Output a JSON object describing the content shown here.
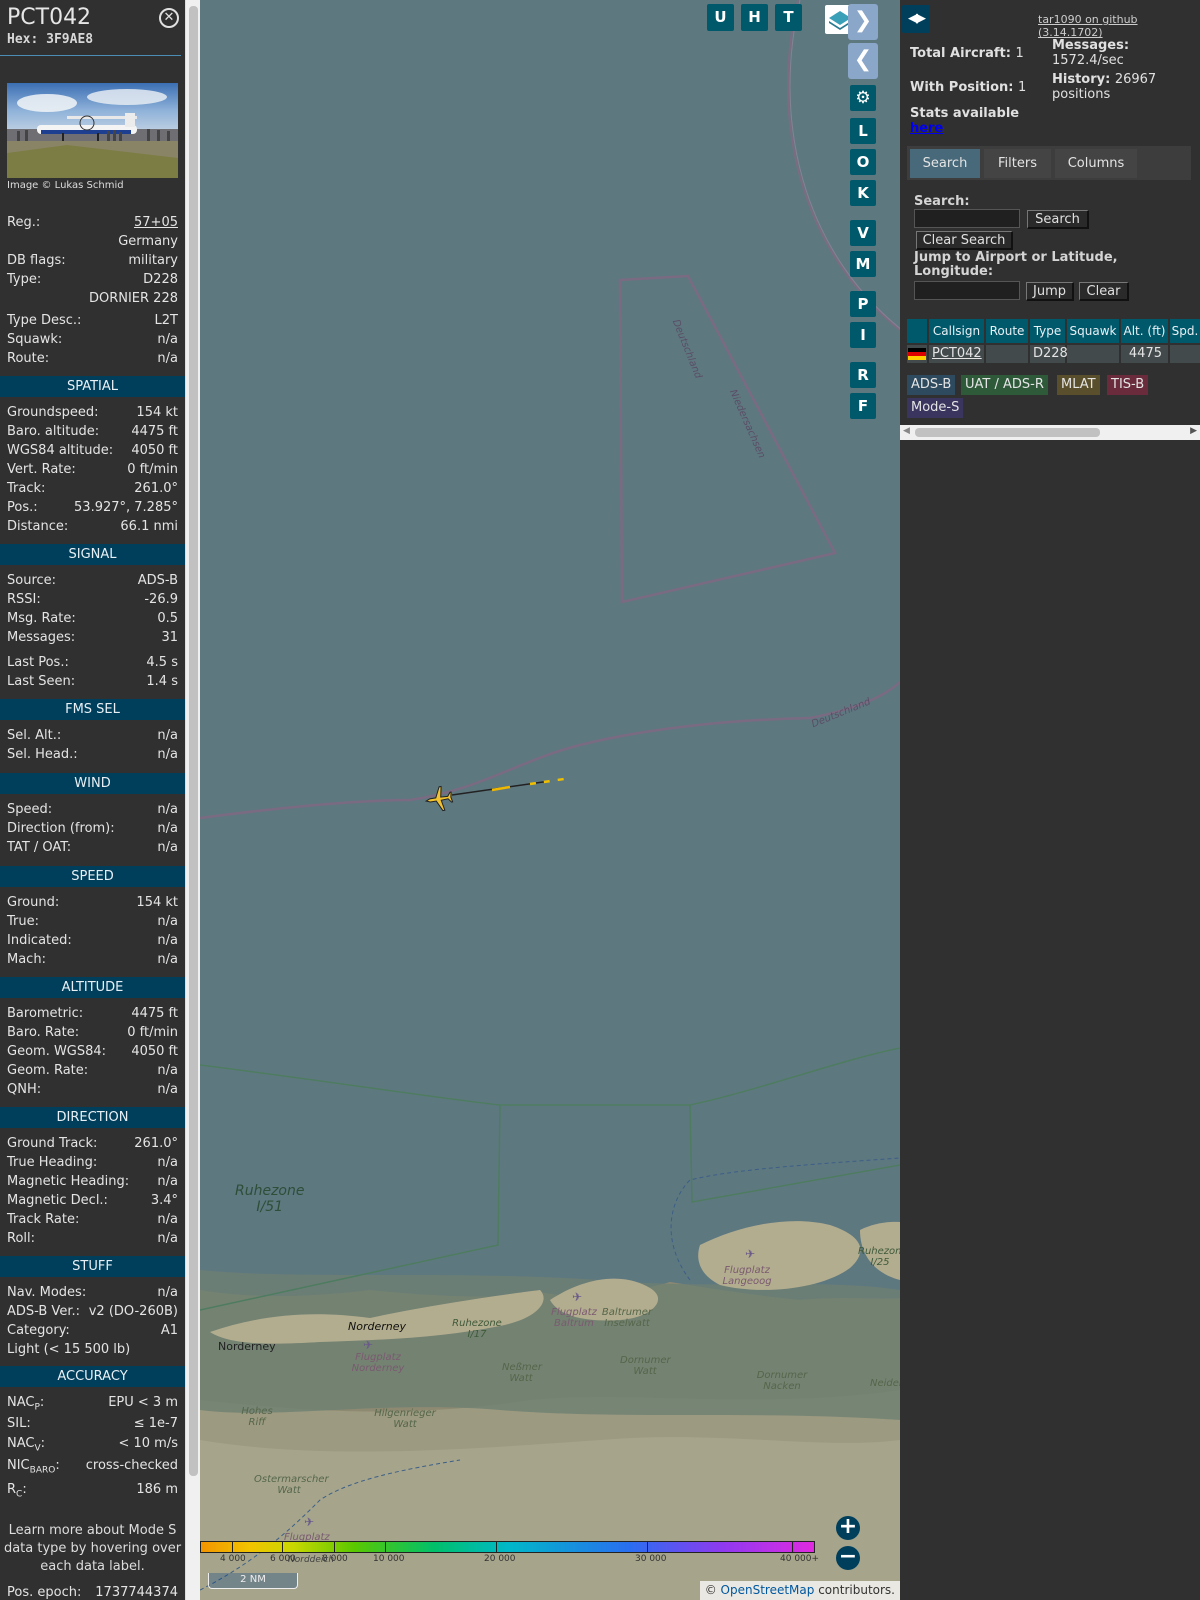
{
  "aircraft": {
    "callsign": "PCT042",
    "hex": "Hex: 3F9AE8",
    "photo_credit": "Image © Lukas Schmid",
    "reg_label": "Reg.:",
    "reg_value": "57+05",
    "country": "Germany",
    "dbflags_label": "DB flags:",
    "dbflags_value": "military",
    "type_label": "Type:",
    "type_value": "D228",
    "type_name": "DORNIER 228",
    "typedesc_label": "Type Desc.:",
    "typedesc_value": "L2T",
    "squawk_label": "Squawk:",
    "squawk_value": "n/a",
    "route_label": "Route:",
    "route_value": "n/a"
  },
  "sections": {
    "spatial": "SPATIAL",
    "signal": "SIGNAL",
    "fms": "FMS SEL",
    "wind": "WIND",
    "speed": "SPEED",
    "altitude": "ALTITUDE",
    "direction": "DIRECTION",
    "stuff": "STUFF",
    "accuracy": "ACCURACY"
  },
  "spatial": [
    [
      "Groundspeed:",
      "154 kt"
    ],
    [
      "Baro. altitude:",
      "4475 ft"
    ],
    [
      "WGS84 altitude:",
      "4050 ft"
    ],
    [
      "Vert. Rate:",
      "0 ft/min"
    ],
    [
      "Track:",
      "261.0°"
    ],
    [
      "Pos.:",
      "53.927°, 7.285°"
    ],
    [
      "Distance:",
      "66.1 nmi"
    ]
  ],
  "signal": [
    [
      "Source:",
      "ADS-B"
    ],
    [
      "RSSI:",
      "-26.9"
    ],
    [
      "Msg. Rate:",
      "0.5"
    ],
    [
      "Messages:",
      "31"
    ],
    [
      "Last Pos.:",
      "4.5 s"
    ],
    [
      "Last Seen:",
      "1.4 s"
    ]
  ],
  "fms": [
    [
      "Sel. Alt.:",
      "n/a"
    ],
    [
      "Sel. Head.:",
      "n/a"
    ]
  ],
  "wind": [
    [
      "Speed:",
      "n/a"
    ],
    [
      "Direction (from):",
      "n/a"
    ],
    [
      "TAT / OAT:",
      "n/a"
    ]
  ],
  "speed": [
    [
      "Ground:",
      "154 kt"
    ],
    [
      "True:",
      "n/a"
    ],
    [
      "Indicated:",
      "n/a"
    ],
    [
      "Mach:",
      "n/a"
    ]
  ],
  "altitude": [
    [
      "Barometric:",
      "4475 ft"
    ],
    [
      "Baro. Rate:",
      "0 ft/min"
    ],
    [
      "Geom. WGS84:",
      "4050 ft"
    ],
    [
      "Geom. Rate:",
      "n/a"
    ],
    [
      "QNH:",
      "n/a"
    ]
  ],
  "direction": [
    [
      "Ground Track:",
      "261.0°"
    ],
    [
      "True Heading:",
      "n/a"
    ],
    [
      "Magnetic Heading:",
      "n/a"
    ],
    [
      "Magnetic Decl.:",
      "3.4°"
    ],
    [
      "Track Rate:",
      "n/a"
    ],
    [
      "Roll:",
      "n/a"
    ]
  ],
  "stuff": [
    [
      "Nav. Modes:",
      "n/a"
    ],
    [
      "ADS-B Ver.:",
      "v2 (DO-260B)"
    ],
    [
      "Category:",
      "A1"
    ]
  ],
  "stuff_extra": "Light (< 15 500 lb)",
  "accuracy": {
    "nacp_label": "NAC",
    "nacp_sub": "P",
    "nacp_value": "EPU < 3 m",
    "sil_label": "SIL:",
    "sil_value": "≤ 1e-7",
    "nacv_label": "NAC",
    "nacv_sub": "V",
    "nacv_value": "< 10 m/s",
    "nicbaro_label": "NIC",
    "nicbaro_sub": "BARO",
    "nicbaro_value": "cross-checked",
    "rc_label": "R",
    "rc_sub": "C",
    "rc_value": "186 m"
  },
  "learn_more": "Learn more about Mode S data type by hovering over each data label.",
  "pos_epoch_label": "Pos. epoch:",
  "pos_epoch_value": "1737744374",
  "map": {
    "buttons_top": [
      "U",
      "H",
      "T"
    ],
    "buttons_side": [
      "L",
      "O",
      "K",
      "V",
      "M",
      "P",
      "I",
      "R",
      "F"
    ],
    "labels": {
      "deutschland1": "Deutschland",
      "niedersachsen": "Niedersachsen",
      "deutschland2": "Deutschland",
      "ruhezone": "Ruhezone",
      "ruhezone_id": "I/51",
      "norderney_town": "Norderney",
      "norderney_island": "Norderney",
      "flugplatz_norderney": "Flugplatz Norderney",
      "ruhezone_i17": "Ruhezone I/17",
      "flugplatz_baltrum": "Flugplatz Baltrum",
      "baltrumer": "Baltrumer Inselwatt",
      "flugplatz_langeoog": "Flugplatz Langeoog",
      "ruhezone_i25": "Ruhezone I/25",
      "nessmer": "Neßmer Watt",
      "dornumer": "Dornumer Watt",
      "dornumer_nacken": "Dornumer Nacken",
      "neider": "Neider",
      "hohes_riff": "Hohes Riff",
      "hilgenrieger": "Hilgenrieger Watt",
      "ostermarscher": "Ostermarscher Watt",
      "flugplatz_norddeich": "Flugplatz Norddeich",
      "norddeich": "Norddeich"
    },
    "alt_scale": [
      "4 000",
      "6 000",
      "8 000",
      "10 000",
      "20 000",
      "30 000",
      "40 000+"
    ],
    "scale_bar": "2 NM",
    "attribution_prefix": "© ",
    "attribution_link": "OpenStreetMap",
    "attribution_suffix": " contributors."
  },
  "panel": {
    "github_link": "tar1090 on github (3.14.1702)",
    "total_label": "Total Aircraft:",
    "total_value": "1",
    "messages_label": "Messages:",
    "messages_value": "1572.4/sec",
    "withpos_label": "With Position:",
    "withpos_value": "1",
    "history_label": "History:",
    "history_value": "26967 positions",
    "stats_text": "Stats available",
    "stats_link": "here",
    "tabs": [
      "Search",
      "Filters",
      "Columns"
    ],
    "search_label": "Search:",
    "search_button": "Search",
    "clear_search_button": "Clear Search",
    "jump_label": "Jump to Airport or Latitude, Longitude:",
    "jump_button": "Jump",
    "clear_button": "Clear",
    "columns": [
      "Callsign",
      "Route",
      "Type",
      "Squawk",
      "Alt. (ft)",
      "Spd."
    ],
    "row": {
      "callsign": "PCT042",
      "route": "",
      "type": "D228",
      "squawk": "",
      "alt": "4475"
    },
    "legend": [
      "ADS-B",
      "UAT / ADS-R",
      "MLAT",
      "TIS-B",
      "Mode-S"
    ]
  },
  "colors": {
    "section": "#003f5c",
    "map_sea": "#5e7880",
    "adsb": "#2d4a5e",
    "uat": "#2e5a3a",
    "mlat": "#5a4f2c",
    "tisb": "#6a2c3c",
    "modes": "#3a355e"
  }
}
